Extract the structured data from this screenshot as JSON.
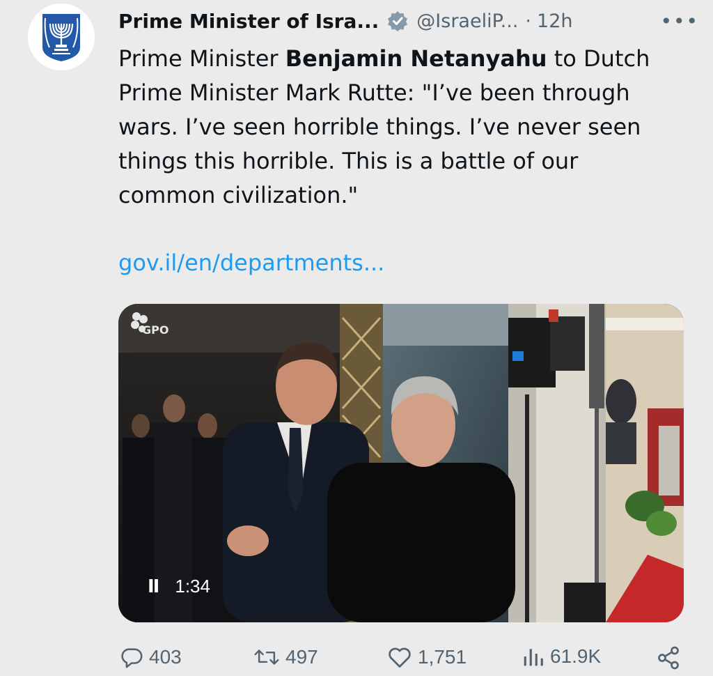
{
  "tweet": {
    "author_name": "Prime Minister of Isra...",
    "handle": "@IsraeliP...",
    "separator": "·",
    "time": "12h",
    "more_label": "•••",
    "text_part1": "Prime Minister ",
    "text_bold": "Benjamin Netanyahu",
    "text_part2": " to Dutch Prime Minister Mark Rutte: \"I’ve been through wars. I’ve seen horrible things. I’ve never seen things this horrible. This is a battle of our common civilization.\"",
    "link": "gov.il/en/departments..."
  },
  "media": {
    "watermark": "GPO",
    "pause_icon": "II",
    "duration": "1:34"
  },
  "actions": {
    "replies": "403",
    "reposts": "497",
    "likes": "1,751",
    "views": "61.9K"
  },
  "icons": {
    "avatar": "emblem-of-israel-icon",
    "verified": "verified-badge-icon",
    "reply": "reply-icon",
    "repost": "repost-icon",
    "like": "heart-icon",
    "views": "views-chart-icon",
    "share": "share-icon"
  },
  "colors": {
    "background": "#ebebeb",
    "text": "#0f1419",
    "secondary": "#536471",
    "link": "#1d9bf0",
    "emblem_blue": "#2458a8"
  }
}
